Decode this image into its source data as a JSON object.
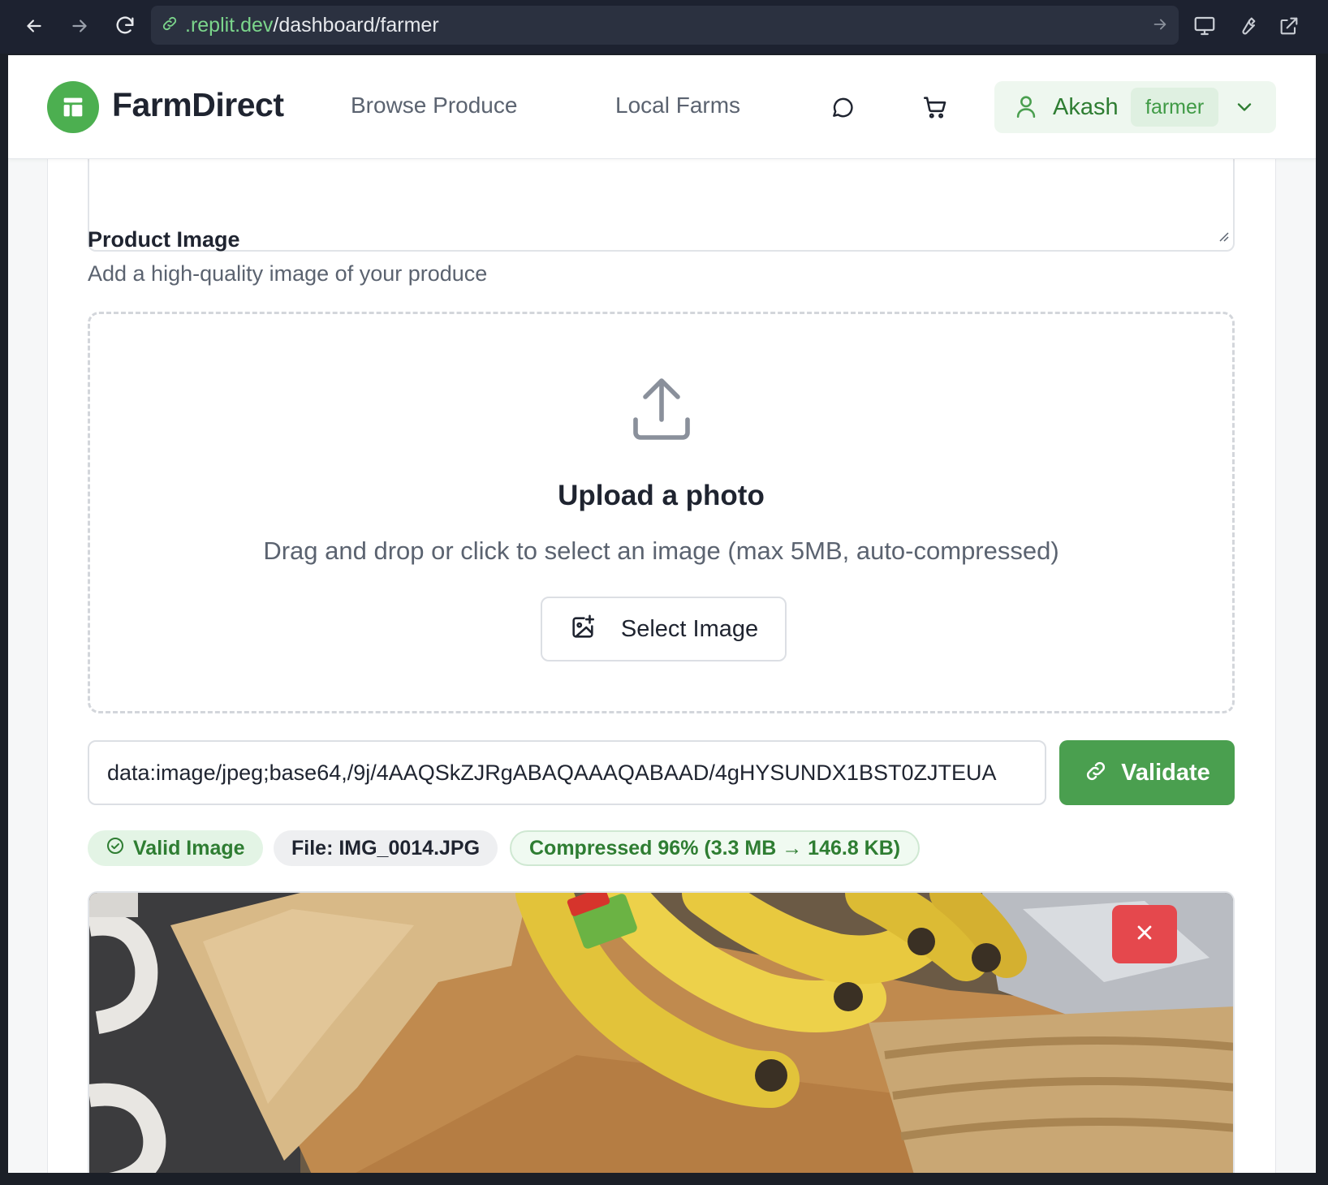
{
  "browser": {
    "url_host": ".replit.dev",
    "url_path": "/dashboard/farmer"
  },
  "brand": {
    "name": "FarmDirect",
    "accent": "#4caf50"
  },
  "nav": {
    "browse": "Browse Produce",
    "farms": "Local Farms"
  },
  "user": {
    "name": "Akash",
    "role": "farmer"
  },
  "image_section": {
    "title": "Product Image",
    "subtitle": "Add a high-quality image of your produce"
  },
  "dropzone": {
    "title": "Upload a photo",
    "description": "Drag and drop or click to select an image (max 5MB, auto-compressed)",
    "button_label": "Select Image"
  },
  "image_url": {
    "value": "data:image/jpeg;base64,/9j/4AAQSkZJRgABAQAAAQABAAD/4gHYSUNDX1BST0ZJTEUA",
    "validate_label": "Validate"
  },
  "status": {
    "valid": "Valid Image",
    "file": "File: IMG_0014.JPG",
    "compressed": "Compressed 96% (3.3 MB → 146.8 KB)"
  },
  "colors": {
    "primary_green": "#4a9f4f",
    "danger": "#e5484d"
  }
}
